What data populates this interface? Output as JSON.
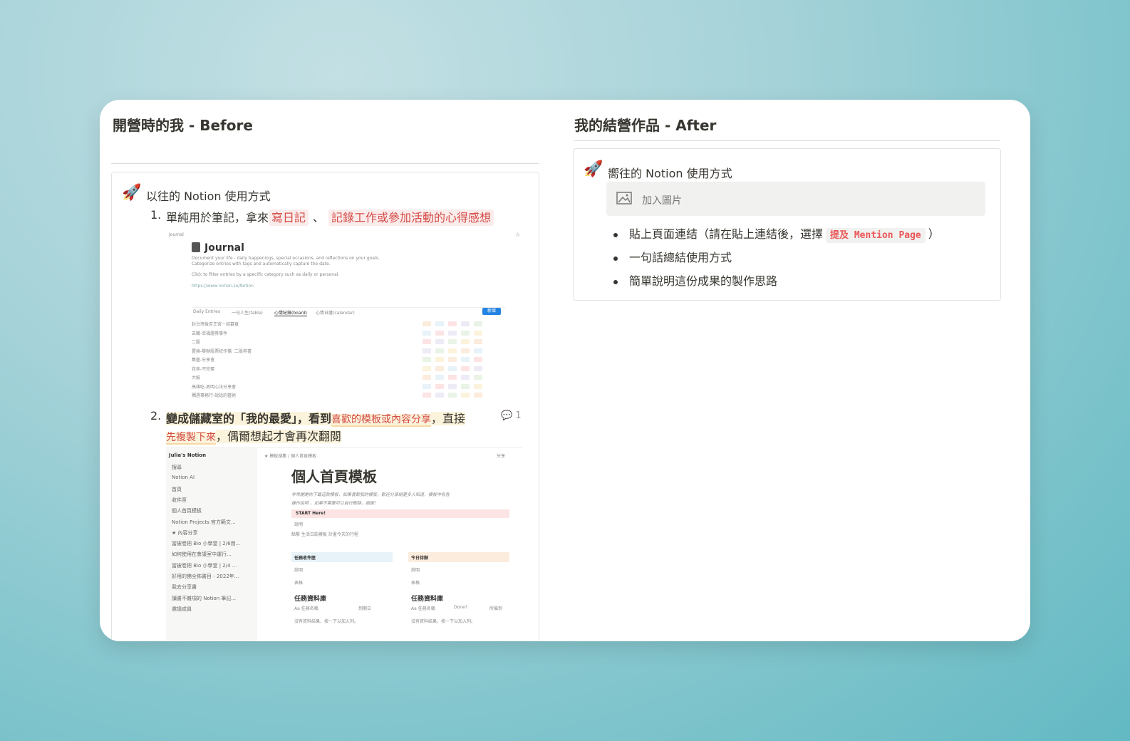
{
  "before": {
    "title": "開營時的我 - Before",
    "callout_title": "以往的 Notion 使用方式",
    "item1": {
      "num": "1.",
      "prefix": "單純用於筆記，拿來",
      "tag1": "寫日記",
      "sep": "、",
      "tag2": "記錄工作或參加活動的心得感想"
    },
    "item2": {
      "num": "2.",
      "part1": "變成儲藏室的「我的最愛」，看到",
      "red1": "喜歡的模板或內容分享",
      "part2": "，直接",
      "red2": "先複製下來",
      "part3": "，偶爾想起才會再次翻閱",
      "comment_count": "1"
    },
    "journal_shot": {
      "breadcrumb": "Journal",
      "title": "Journal",
      "desc1": "Document your life - daily happenings, special occasions, and reflections on your goals.",
      "desc2": "Categorize entries with tags and automatically capture the date.",
      "desc3": "Click to filter entries by a specific category such as daily or personal.",
      "link": "https://www.notion.so/Notion",
      "tabs": [
        "Daily Entries",
        "一句人生(table)",
        "心情紀錄(board)",
        "心情日曆(calendar)"
      ],
      "new_button": "新增",
      "rows": [
        "封台灣後百王宮－招募頁",
        "去職-幸福證券事件",
        "二股",
        "置換-舉辦股票紀作僑 ·二股券書",
        "集藝-分享會",
        "花丰-不完蛋",
        "大紙",
        "高雄吃-男明心法分享會",
        "獨週事務行-說話的藝術"
      ]
    },
    "notion_shot": {
      "workspace": "Julia's Notion",
      "sidebar": [
        "搜尋",
        "Notion AI",
        "首頁",
        "收件匣",
        "個人首頁模板",
        "Notion Projects 官方範文...",
        "★ 內容分享",
        "當被卷把 Bio 小學堂 | 2/6用...",
        "如何使用在會議室中運行...",
        "當被卷把 Bio 小學堂 | 2/4 ...",
        "好用的佛全佈書目 - 2022年...",
        "我去分享書",
        "讀書不雜項的 Notion 筆記...",
        "邀請成員"
      ],
      "breadcrumb": "★ 模板搜集 / 個人首頁模板",
      "share": "分享",
      "page_title": "個人首頁模板",
      "intro1": "非常謝謝你下載這款模板，如果喜歡我的模版，歡迎分享給更多人知道，模板中有各",
      "intro2": "操作說明 ，如果不需要可以自行刪除，謝謝！",
      "start": "START Here!",
      "explain": "說明",
      "daily": "點擊 生活日誌模板 計畫今天的行程",
      "inbox": "任務收件匣",
      "todo": "今日待辦",
      "db": "任務資料庫",
      "view": "表格",
      "col_name": "Aa 任務名稱",
      "col_date": "到期日",
      "col_done": "Done?",
      "col_owner": "所屬到",
      "empty": "沒有資料結果，按一下以加入列。"
    }
  },
  "after": {
    "title": "我的結營作品 - After",
    "callout_title": "嚮往的 Notion 使用方式",
    "add_image": "加入圖片",
    "bullet1_prefix": "貼上頁面連結（請在貼上連結後，選擇",
    "bullet1_mention": "提及 Mention Page",
    "bullet1_suffix": "）",
    "bullet2": "一句話總結使用方式",
    "bullet3": "簡單說明這份成果的製作思路"
  },
  "colors": {
    "red": "#d44c47",
    "highlight_yellow": "#fbf3db",
    "callout_bg": "#f1f1ef"
  }
}
